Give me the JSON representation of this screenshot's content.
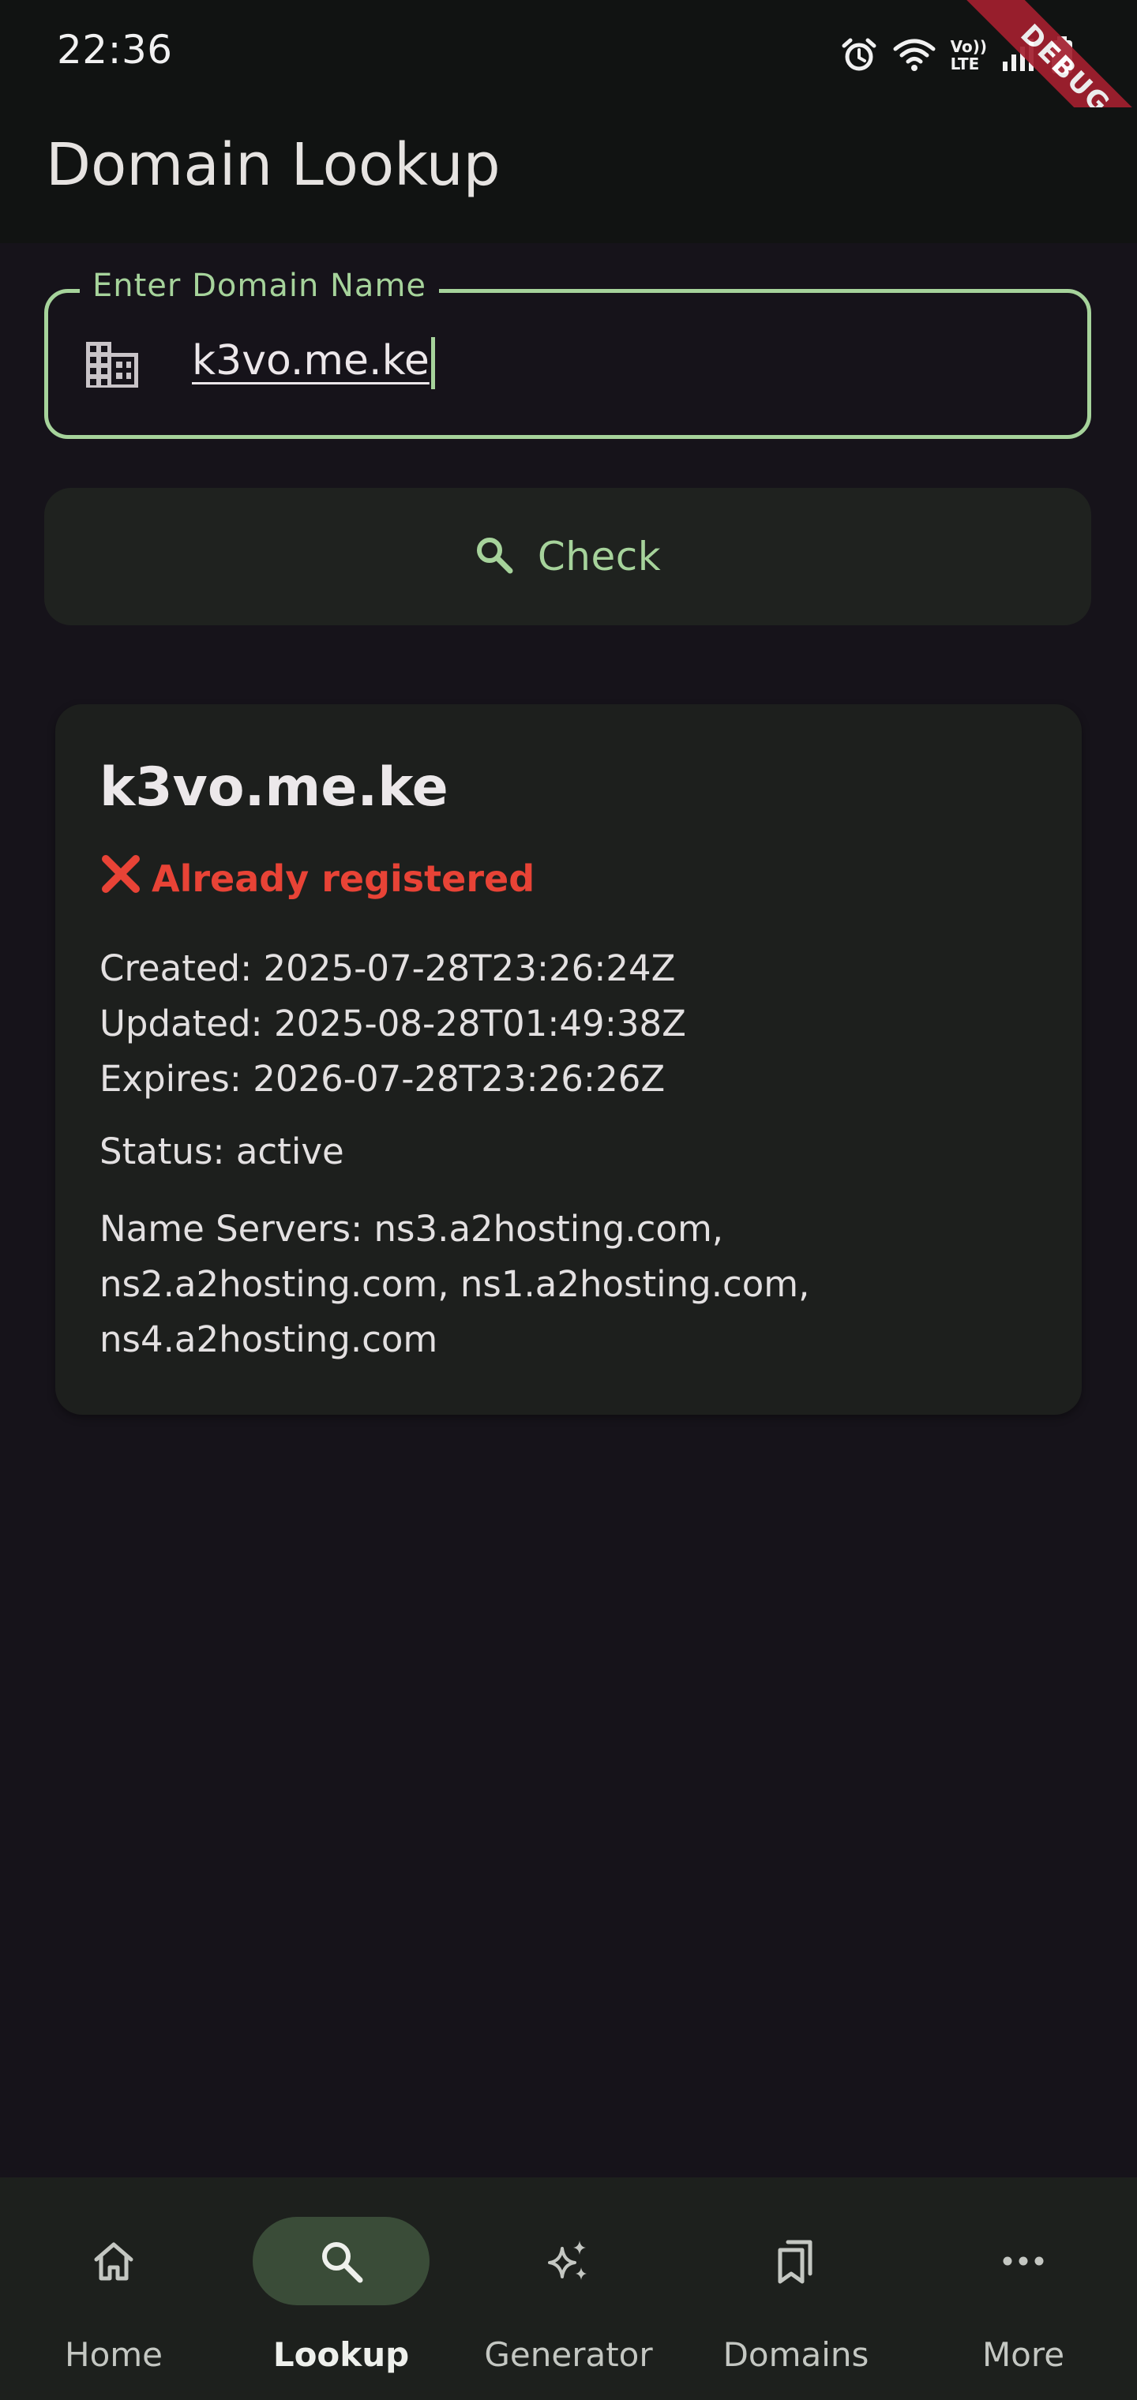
{
  "status_bar": {
    "time": "22:36",
    "icons": [
      "alarm-icon",
      "wifi-icon",
      "volte-icon",
      "signal-icon",
      "battery-icon"
    ],
    "volte_line1": "Vo))",
    "volte_line2": "LTE"
  },
  "debug_banner": {
    "label": "DEBUG"
  },
  "app_bar": {
    "title": "Domain Lookup"
  },
  "search": {
    "label": "Enter Domain Name",
    "value": "k3vo.me.ke",
    "icon": "building-icon"
  },
  "check_button": {
    "label": "Check",
    "icon": "search-icon"
  },
  "result": {
    "domain": "k3vo.me.ke",
    "availability": "Already registered",
    "availability_icon": "cross-mark-icon",
    "created": "Created: 2025-07-28T23:26:24Z",
    "updated": "Updated: 2025-08-28T01:49:38Z",
    "expires": "Expires: 2026-07-28T23:26:26Z",
    "status": "Status: active",
    "name_servers": "Name Servers: ns3.a2hosting.com, ns2.a2hosting.com, ns1.a2hosting.com, ns4.a2hosting.com"
  },
  "bottom_nav": {
    "selected": "Lookup",
    "items": [
      {
        "label": "Home",
        "icon": "home-icon"
      },
      {
        "label": "Lookup",
        "icon": "search-icon"
      },
      {
        "label": "Generator",
        "icon": "sparkle-icon"
      },
      {
        "label": "Domains",
        "icon": "bookmarks-icon"
      },
      {
        "label": "More",
        "icon": "more-horizontal-icon"
      }
    ]
  },
  "colors": {
    "background": "#16131a",
    "app_bar": "#111312",
    "accent": "#a6d39b",
    "card": "#1d1f1d",
    "error": "#e84336",
    "nav_active_pill": "#3a4c38"
  }
}
